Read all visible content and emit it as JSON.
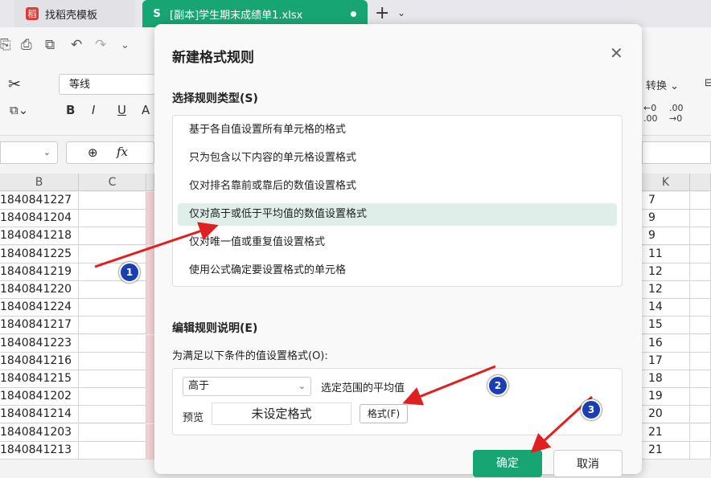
{
  "tabs": [
    {
      "label": "找稻壳模板",
      "logo": "稻"
    },
    {
      "label": "[副本]学生期末成绩单1.xlsx",
      "icon_letter": "S"
    }
  ],
  "tab_controls": {
    "plus": "+",
    "chevron": "⌄"
  },
  "ribbon": {
    "font_name": "等线",
    "bold": "B",
    "italic": "I",
    "underline": "U",
    "convert_label": "转换 ⌄"
  },
  "formula_bar": {
    "fx": "fx"
  },
  "sheet": {
    "col_b": "B",
    "col_c": "C",
    "col_k": "K",
    "b_values": [
      "1840841227",
      "1840841204",
      "1840841218",
      "1840841225",
      "1840841219",
      "1840841220",
      "1840841224",
      "1840841217",
      "1840841223",
      "1840841216",
      "1840841215",
      "1840841202",
      "1840841214",
      "1840841203",
      "1840841213"
    ],
    "k_values": [
      "7",
      "9",
      "9",
      "11",
      "12",
      "12",
      "14",
      "15",
      "16",
      "17",
      "18",
      "19",
      "20",
      "21",
      "21"
    ]
  },
  "dialog": {
    "title": "新建格式规则",
    "section_rule_type": "选择规则类型(S)",
    "rules": [
      "基于各自值设置所有单元格的格式",
      "只为包含以下内容的单元格设置格式",
      "仅对排名靠前或靠后的数值设置格式",
      "仅对高于或低于平均值的数值设置格式",
      "仅对唯一值或重复值设置格式",
      "使用公式确定要设置格式的单元格"
    ],
    "selected_rule_index": 3,
    "section_edit": "编辑规则说明(E)",
    "condition_label": "为满足以下条件的值设置格式(O):",
    "condition_value": "高于",
    "range_text": "选定范围的平均值",
    "preview_label": "预览",
    "preview_text": "未设定格式",
    "format_button": "格式(F)",
    "ok_button": "确定",
    "cancel_button": "取消"
  },
  "annotations": {
    "badge1": "1",
    "badge2": "2",
    "badge3": "3",
    "arrow_color": "#e02020"
  }
}
